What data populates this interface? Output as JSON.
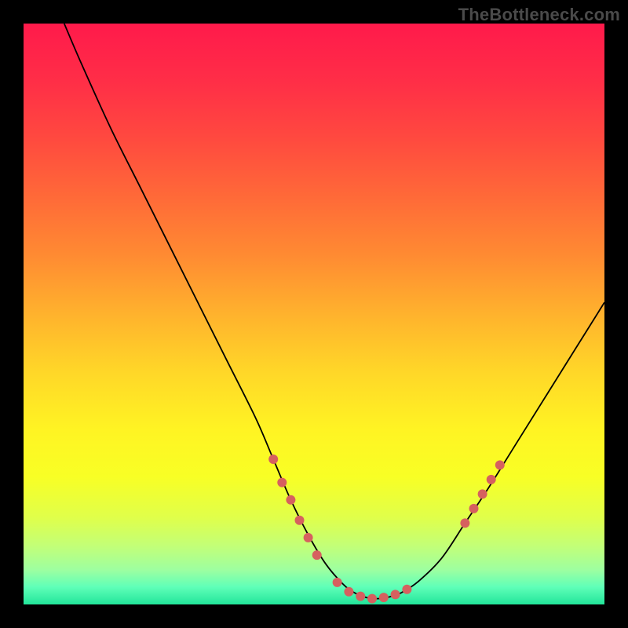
{
  "watermark": "TheBottleneck.com",
  "chart_data": {
    "type": "line",
    "title": "",
    "xlabel": "",
    "ylabel": "",
    "xlim": [
      0,
      100
    ],
    "ylim": [
      0,
      100
    ],
    "background_gradient": [
      {
        "stop": 0,
        "color": "#ff1a4b"
      },
      {
        "stop": 10,
        "color": "#ff2e47"
      },
      {
        "stop": 20,
        "color": "#ff4a3f"
      },
      {
        "stop": 30,
        "color": "#ff6a38"
      },
      {
        "stop": 40,
        "color": "#ff8b32"
      },
      {
        "stop": 50,
        "color": "#ffb22d"
      },
      {
        "stop": 60,
        "color": "#ffd728"
      },
      {
        "stop": 70,
        "color": "#fff423"
      },
      {
        "stop": 78,
        "color": "#f8ff25"
      },
      {
        "stop": 85,
        "color": "#e0ff4a"
      },
      {
        "stop": 90,
        "color": "#c2ff78"
      },
      {
        "stop": 94,
        "color": "#9effa0"
      },
      {
        "stop": 97,
        "color": "#5fffb8"
      },
      {
        "stop": 100,
        "color": "#22e59a"
      }
    ],
    "series": [
      {
        "name": "bottleneck-curve",
        "x": [
          7,
          10,
          15,
          20,
          25,
          30,
          35,
          40,
          43,
          46,
          49,
          52,
          55,
          57,
          59,
          61,
          63,
          65,
          68,
          72,
          76,
          80,
          85,
          90,
          95,
          100
        ],
        "y": [
          100,
          93,
          82,
          72,
          62,
          52,
          42,
          32,
          25,
          18,
          12,
          7,
          3.5,
          2,
          1.2,
          1,
          1.3,
          2,
          4,
          8,
          14,
          20,
          28,
          36,
          44,
          52
        ]
      }
    ],
    "markers": {
      "name": "highlighted-points",
      "color": "#d6605f",
      "radius": 6,
      "points": [
        {
          "x": 43,
          "y": 25
        },
        {
          "x": 44.5,
          "y": 21
        },
        {
          "x": 46,
          "y": 18
        },
        {
          "x": 47.5,
          "y": 14.5
        },
        {
          "x": 49,
          "y": 11.5
        },
        {
          "x": 50.5,
          "y": 8.5
        },
        {
          "x": 54,
          "y": 3.8
        },
        {
          "x": 56,
          "y": 2.2
        },
        {
          "x": 58,
          "y": 1.4
        },
        {
          "x": 60,
          "y": 1.0
        },
        {
          "x": 62,
          "y": 1.2
        },
        {
          "x": 64,
          "y": 1.7
        },
        {
          "x": 66,
          "y": 2.6
        },
        {
          "x": 76,
          "y": 14
        },
        {
          "x": 77.5,
          "y": 16.5
        },
        {
          "x": 79,
          "y": 19
        },
        {
          "x": 80.5,
          "y": 21.5
        },
        {
          "x": 82,
          "y": 24
        }
      ]
    }
  }
}
